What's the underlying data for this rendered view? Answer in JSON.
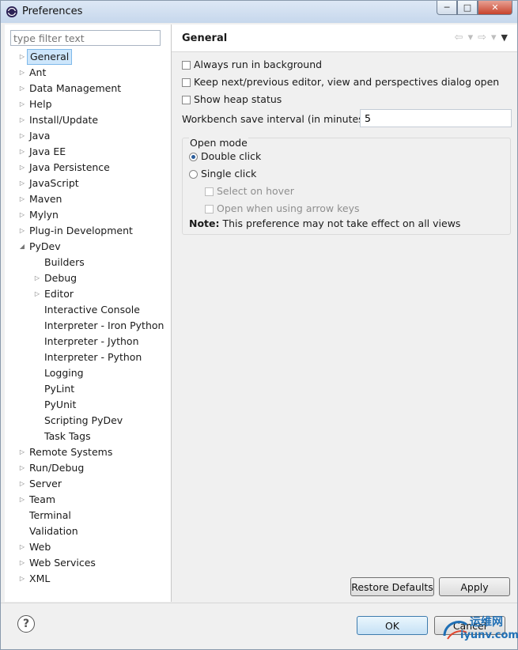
{
  "window": {
    "title": "Preferences",
    "minimize": "─",
    "maximize": "□",
    "close": "✕"
  },
  "filter": {
    "placeholder": "type filter text"
  },
  "tree": [
    {
      "label": "General",
      "level": 0,
      "twisty": "collapsed",
      "selected": true
    },
    {
      "label": "Ant",
      "level": 0,
      "twisty": "collapsed"
    },
    {
      "label": "Data Management",
      "level": 0,
      "twisty": "collapsed"
    },
    {
      "label": "Help",
      "level": 0,
      "twisty": "collapsed"
    },
    {
      "label": "Install/Update",
      "level": 0,
      "twisty": "collapsed"
    },
    {
      "label": "Java",
      "level": 0,
      "twisty": "collapsed"
    },
    {
      "label": "Java EE",
      "level": 0,
      "twisty": "collapsed"
    },
    {
      "label": "Java Persistence",
      "level": 0,
      "twisty": "collapsed"
    },
    {
      "label": "JavaScript",
      "level": 0,
      "twisty": "collapsed"
    },
    {
      "label": "Maven",
      "level": 0,
      "twisty": "collapsed"
    },
    {
      "label": "Mylyn",
      "level": 0,
      "twisty": "collapsed"
    },
    {
      "label": "Plug-in Development",
      "level": 0,
      "twisty": "collapsed"
    },
    {
      "label": "PyDev",
      "level": 0,
      "twisty": "expanded"
    },
    {
      "label": "Builders",
      "level": 1,
      "twisty": "none"
    },
    {
      "label": "Debug",
      "level": 1,
      "twisty": "collapsed"
    },
    {
      "label": "Editor",
      "level": 1,
      "twisty": "collapsed"
    },
    {
      "label": "Interactive Console",
      "level": 1,
      "twisty": "none"
    },
    {
      "label": "Interpreter - Iron Python",
      "level": 1,
      "twisty": "none"
    },
    {
      "label": "Interpreter - Jython",
      "level": 1,
      "twisty": "none"
    },
    {
      "label": "Interpreter - Python",
      "level": 1,
      "twisty": "none"
    },
    {
      "label": "Logging",
      "level": 1,
      "twisty": "none"
    },
    {
      "label": "PyLint",
      "level": 1,
      "twisty": "none"
    },
    {
      "label": "PyUnit",
      "level": 1,
      "twisty": "none"
    },
    {
      "label": "Scripting PyDev",
      "level": 1,
      "twisty": "none"
    },
    {
      "label": "Task Tags",
      "level": 1,
      "twisty": "none"
    },
    {
      "label": "Remote Systems",
      "level": 0,
      "twisty": "collapsed"
    },
    {
      "label": "Run/Debug",
      "level": 0,
      "twisty": "collapsed"
    },
    {
      "label": "Server",
      "level": 0,
      "twisty": "collapsed"
    },
    {
      "label": "Team",
      "level": 0,
      "twisty": "collapsed"
    },
    {
      "label": "Terminal",
      "level": 0,
      "twisty": "none"
    },
    {
      "label": "Validation",
      "level": 0,
      "twisty": "none"
    },
    {
      "label": "Web",
      "level": 0,
      "twisty": "collapsed"
    },
    {
      "label": "Web Services",
      "level": 0,
      "twisty": "collapsed"
    },
    {
      "label": "XML",
      "level": 0,
      "twisty": "collapsed"
    }
  ],
  "page": {
    "title": "General",
    "nav": {
      "back": "⇦",
      "back_menu": "▾",
      "forward": "⇨",
      "forward_menu": "▾",
      "view_menu": "▼"
    },
    "options": {
      "always_run_background": {
        "label": "Always run in background",
        "checked": false
      },
      "keep_next_prev": {
        "label": "Keep next/previous editor, view and perspectives dialog open",
        "checked": false
      },
      "show_heap": {
        "label": "Show heap status",
        "checked": false
      }
    },
    "save_interval": {
      "label": "Workbench save interval (in minutes):",
      "value": "5"
    },
    "open_mode": {
      "title": "Open mode",
      "double_click": {
        "label": "Double click",
        "selected": true
      },
      "single_click": {
        "label": "Single click",
        "selected": false
      },
      "select_on_hover": {
        "label": "Select on hover",
        "enabled": false
      },
      "open_arrow_keys": {
        "label": "Open when using arrow keys",
        "enabled": false
      },
      "note_label": "Note:",
      "note_text": " This preference may not take effect on all views"
    }
  },
  "buttons": {
    "restore_defaults": "Restore Defaults",
    "apply": "Apply",
    "ok": "OK",
    "cancel": "Cancel",
    "help": "?"
  },
  "watermark": {
    "line1": "运维网",
    "line2": "iyunv.com"
  }
}
